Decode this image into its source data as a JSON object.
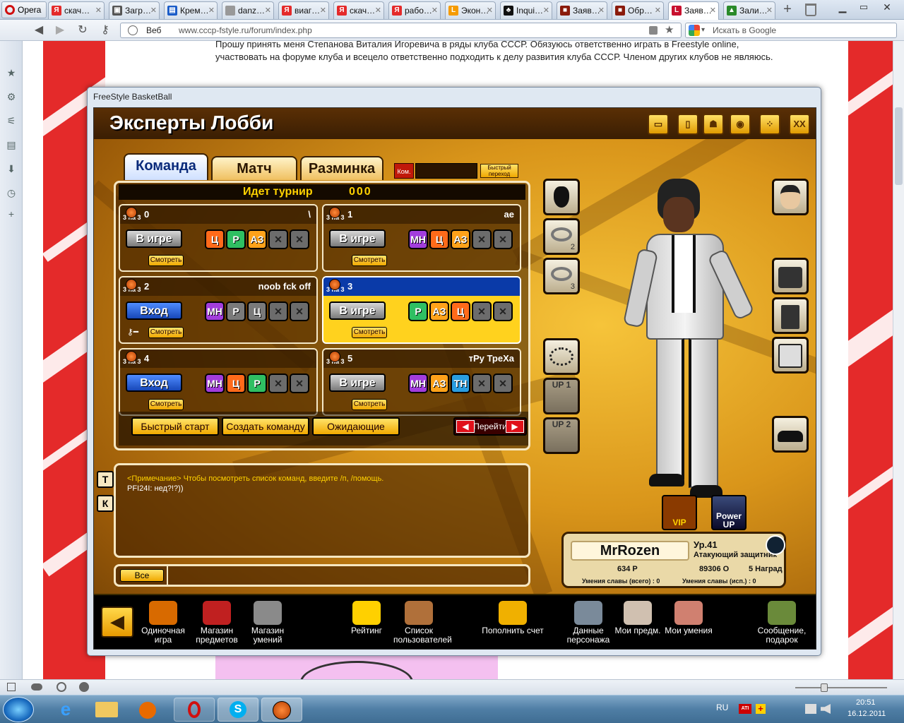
{
  "browser": {
    "menu_label": "Opera",
    "tabs": [
      {
        "label": "скач…",
        "icon_color": "#e42a2a",
        "icon": "Я"
      },
      {
        "label": "Загр…",
        "icon_color": "#555",
        "icon": "▣"
      },
      {
        "label": "Крем…",
        "icon_color": "#1a5cc8",
        "icon": "▤"
      },
      {
        "label": "danz…",
        "icon_color": "#999",
        "icon": ""
      },
      {
        "label": "виаг…",
        "icon_color": "#e42a2a",
        "icon": "Я"
      },
      {
        "label": "скач…",
        "icon_color": "#e42a2a",
        "icon": "Я"
      },
      {
        "label": "рабо…",
        "icon_color": "#e42a2a",
        "icon": "Я"
      },
      {
        "label": "Экон…",
        "icon_color": "#f59b00",
        "icon": "L"
      },
      {
        "label": "Inqui…",
        "icon_color": "#111",
        "icon": "♣"
      },
      {
        "label": "Заяв…",
        "icon_color": "#8a1a0a",
        "icon": "■"
      },
      {
        "label": "Обр…",
        "icon_color": "#8a1a0a",
        "icon": "■"
      },
      {
        "label": "Заяв…",
        "icon_color": "#c8102e",
        "icon": "L",
        "active": true
      },
      {
        "label": "Зали…",
        "icon_color": "#2a8a2a",
        "icon": "▲"
      }
    ],
    "web_label": "Веб",
    "url": "www.cccp-fstyle.ru/forum/index.php",
    "search_placeholder": "Искать в Google"
  },
  "page": {
    "text_line1": "Прошу принять меня Степанова Виталия Игоревича в ряды клуба СССР. Обязуюсь ответственно играть в Freestyle online,",
    "text_line2": "участвовать на форуме клуба и всецело ответственно подходить к делу развития клуба СССР. Членом других клубов не являюсь."
  },
  "game": {
    "window_title": "FreeStyle BasketBall",
    "lobby_title": "Эксперты Лобби",
    "header_icons": [
      "box-icon",
      "door-icon",
      "figure-icon",
      "shirt-icon",
      "dice-icon",
      "xx-icon"
    ],
    "tabs": {
      "team": "Команда",
      "match": "Матч",
      "warmup": "Разминка"
    },
    "kom_label": "Ком.",
    "quick_jump": "Быстрый переход",
    "tournament": {
      "label": "Идет турнир",
      "value": "000"
    },
    "rooms": [
      {
        "number": "0",
        "name": "\\",
        "mode": "3 на 3",
        "state": "В игре",
        "slots": [
          {
            "t": "Ц",
            "c": "C"
          },
          {
            "t": "Р",
            "c": "P"
          },
          {
            "t": "АЗ",
            "c": "AZ"
          },
          {
            "t": "✕",
            "c": "X"
          },
          {
            "t": "✕",
            "c": "X"
          }
        ],
        "watch": "Смотреть"
      },
      {
        "number": "1",
        "name": "ae",
        "mode": "3 на 3",
        "state": "В игре",
        "slots": [
          {
            "t": "МН",
            "c": "MN"
          },
          {
            "t": "Ц",
            "c": "C"
          },
          {
            "t": "АЗ",
            "c": "AZ"
          },
          {
            "t": "✕",
            "c": "X"
          },
          {
            "t": "✕",
            "c": "X"
          }
        ],
        "watch": "Смотреть"
      },
      {
        "number": "2",
        "name": "noob fck off",
        "mode": "3 на 3",
        "state": "Вход",
        "locked": true,
        "slots": [
          {
            "t": "МН",
            "c": "MN"
          },
          {
            "t": "Р",
            "c": "Pg"
          },
          {
            "t": "Ц",
            "c": "Cg"
          },
          {
            "t": "✕",
            "c": "X"
          },
          {
            "t": "✕",
            "c": "X"
          }
        ],
        "watch": "Смотреть"
      },
      {
        "number": "3",
        "name": "",
        "mode": "3 на 3",
        "state": "В игре",
        "selected": true,
        "slots": [
          {
            "t": "Р",
            "c": "P"
          },
          {
            "t": "АЗ",
            "c": "AZ"
          },
          {
            "t": "Ц",
            "c": "C"
          },
          {
            "t": "✕",
            "c": "X"
          },
          {
            "t": "✕",
            "c": "X"
          }
        ],
        "watch": "Смотреть"
      },
      {
        "number": "4",
        "name": "",
        "mode": "3 на 3",
        "state": "Вход",
        "slots": [
          {
            "t": "МН",
            "c": "MN"
          },
          {
            "t": "Ц",
            "c": "C"
          },
          {
            "t": "Р",
            "c": "P"
          },
          {
            "t": "✕",
            "c": "X"
          },
          {
            "t": "✕",
            "c": "X"
          }
        ],
        "watch": "Смотреть"
      },
      {
        "number": "5",
        "name": "тРу ТреХа",
        "mode": "3 на 3",
        "state": "В игре",
        "slots": [
          {
            "t": "МН",
            "c": "MN"
          },
          {
            "t": "АЗ",
            "c": "AZ"
          },
          {
            "t": "ТН",
            "c": "TN"
          },
          {
            "t": "✕",
            "c": "X"
          },
          {
            "t": "✕",
            "c": "X"
          }
        ],
        "watch": "Смотреть"
      }
    ],
    "buttons": {
      "quick_start": "Быстрый старт",
      "create_team": "Создать команду",
      "waiting": "Ожидающие",
      "goto": "Перейти"
    },
    "chat": {
      "note": "<Примечание> Чтобы посмотреть список команд, введите /п, /помощь.",
      "line1": "PFI24I: нед?!?))",
      "side_t": "Т",
      "side_k": "К",
      "all_button": "Все"
    },
    "equipment": {
      "up1": "UP 1",
      "up2": "UP 2",
      "ring2": "2",
      "ring3": "3"
    },
    "vip_label": "VIP",
    "powerup_label": "Power UP",
    "profile": {
      "name": "MrRozen",
      "level": "Ур.41",
      "position": "Атакующий защитник",
      "points": "634 Р",
      "money": "89306 О",
      "awards": "5 Наград",
      "fame_total": "Умения славы (всего) : 0",
      "fame_used": "Умения славы (исп.) : 0"
    },
    "bottom_menu": [
      {
        "label": "Одиночная игра",
        "color": "#d86a00"
      },
      {
        "label": "Магазин предметов",
        "color": "#c02020"
      },
      {
        "label": "Магазин умений",
        "color": "#8a8a8a"
      },
      {
        "label": "Рейтинг",
        "color": "#ffd000"
      },
      {
        "label": "Список пользователей",
        "color": "#b0703a"
      },
      {
        "label": "Пополнить счет",
        "color": "#f0b000"
      },
      {
        "label": "Данные персонажа",
        "color": "#7a8a9a"
      },
      {
        "label": "Мои предм.",
        "color": "#d0c0b0"
      },
      {
        "label": "Мои умения",
        "color": "#d08070"
      },
      {
        "label": "Сообщение, подарок",
        "color": "#6a8a3a"
      }
    ]
  },
  "taskbar": {
    "language": "RU",
    "time": "20:51",
    "date": "16.12.2011"
  }
}
